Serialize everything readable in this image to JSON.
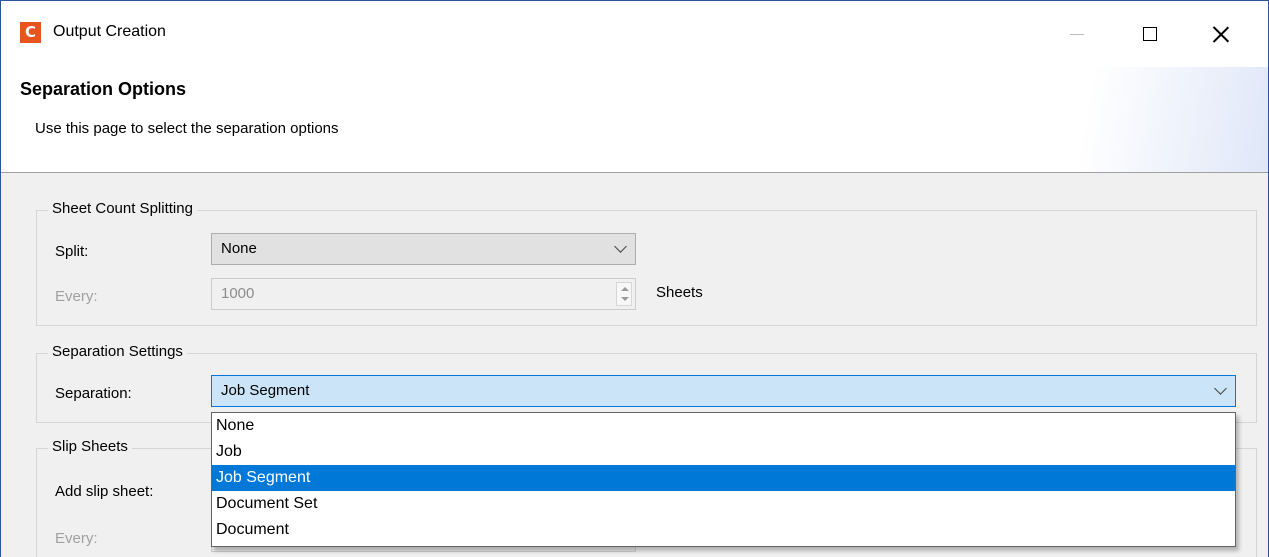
{
  "window": {
    "title": "Output Creation",
    "app_icon_letter": "C"
  },
  "header": {
    "title": "Separation Options",
    "description": "Use this page to select the separation options"
  },
  "sheet_count_splitting": {
    "legend": "Sheet Count Splitting",
    "split_label": "Split:",
    "split_value": "None",
    "every_label": "Every:",
    "every_value": "1000",
    "unit_label": "Sheets"
  },
  "separation_settings": {
    "legend": "Separation Settings",
    "separation_label": "Separation:",
    "separation_value": "Job Segment",
    "options": [
      "None",
      "Job",
      "Job Segment",
      "Document Set",
      "Document"
    ],
    "selected_option": "Job Segment"
  },
  "slip_sheets": {
    "legend": "Slip Sheets",
    "add_label": "Add slip sheet:",
    "every_label": "Every:"
  },
  "colors": {
    "accent": "#0078d7",
    "app_icon": "#e8541e"
  }
}
